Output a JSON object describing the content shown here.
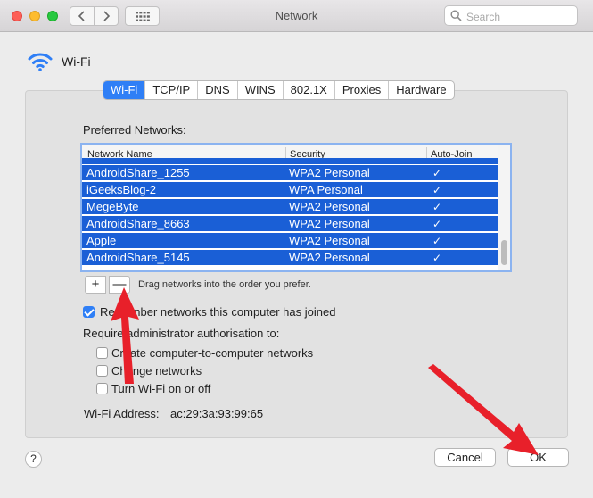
{
  "window": {
    "title": "Network",
    "search_placeholder": "Search"
  },
  "header": {
    "label": "Wi-Fi"
  },
  "tabs": [
    {
      "label": "Wi-Fi",
      "active": true
    },
    {
      "label": "TCP/IP"
    },
    {
      "label": "DNS"
    },
    {
      "label": "WINS"
    },
    {
      "label": "802.1X"
    },
    {
      "label": "Proxies"
    },
    {
      "label": "Hardware"
    }
  ],
  "preferred": {
    "label": "Preferred Networks:",
    "columns": [
      "Network Name",
      "Security",
      "Auto-Join"
    ],
    "rows": [
      {
        "name": "AndroidShare_1255",
        "security": "WPA2 Personal",
        "auto_join": "✓"
      },
      {
        "name": "iGeeksBlog-2",
        "security": "WPA Personal",
        "auto_join": "✓"
      },
      {
        "name": "MegeByte",
        "security": "WPA2 Personal",
        "auto_join": "✓"
      },
      {
        "name": "AndroidShare_8663",
        "security": "WPA2 Personal",
        "auto_join": "✓"
      },
      {
        "name": "Apple",
        "security": "WPA2 Personal",
        "auto_join": "✓"
      },
      {
        "name": "AndroidShare_5145",
        "security": "WPA2 Personal",
        "auto_join": "✓"
      }
    ],
    "add": "+",
    "remove": "—",
    "drag_hint": "Drag networks into the order you prefer."
  },
  "options": {
    "remember": "Remember networks this computer has joined",
    "remember_checked": true,
    "admin_label": "Require administrator authorisation to:",
    "admin_items": [
      {
        "label": "Create computer-to-computer networks",
        "checked": false
      },
      {
        "label": "Change networks",
        "checked": false
      },
      {
        "label": "Turn Wi-Fi on or off",
        "checked": false
      }
    ]
  },
  "address": {
    "label": "Wi-Fi Address:",
    "value": "ac:29:3a:93:99:65"
  },
  "footer": {
    "help": "?",
    "cancel": "Cancel",
    "ok": "OK"
  },
  "colors": {
    "accent": "#2f7ff6",
    "selection": "#1a5fd6",
    "annotation_arrow": "#e8202a"
  }
}
